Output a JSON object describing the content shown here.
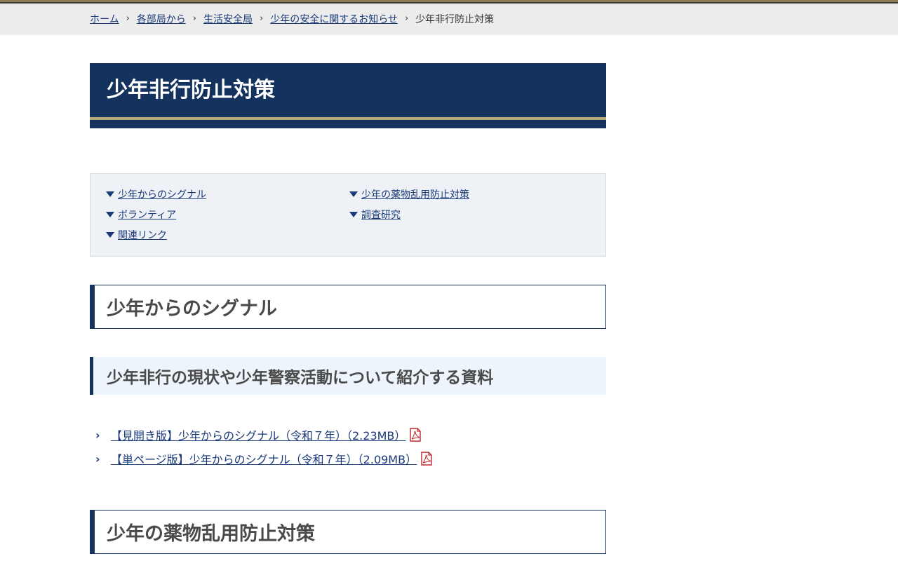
{
  "breadcrumb": {
    "items": [
      "ホーム",
      "各部局から",
      "生活安全局",
      "少年の安全に関するお知らせ"
    ],
    "current": "少年非行防止対策"
  },
  "page": {
    "title": "少年非行防止対策"
  },
  "toc": {
    "left": [
      "少年からのシグナル",
      "ボランティア",
      "関連リンク"
    ],
    "right": [
      "少年の薬物乱用防止対策",
      "調査研究"
    ]
  },
  "section1": {
    "heading": "少年からのシグナル",
    "subheading": "少年非行の現状や少年警察活動について紹介する資料",
    "files": [
      "【見開き版】少年からのシグナル（令和７年）（2.23MB）",
      "【単ページ版】少年からのシグナル（令和７年）（2.09MB）"
    ]
  },
  "section2": {
    "heading": "少年の薬物乱用防止対策"
  },
  "icons": {
    "chevron": "chevron-right-icon",
    "pdf": "pdf-icon",
    "toc_marker": "triangle-down-icon"
  },
  "colors": {
    "navy": "#13325e",
    "gold": "#b7a77b",
    "link": "#1a3a7a",
    "pdf_red": "#c0282d"
  }
}
